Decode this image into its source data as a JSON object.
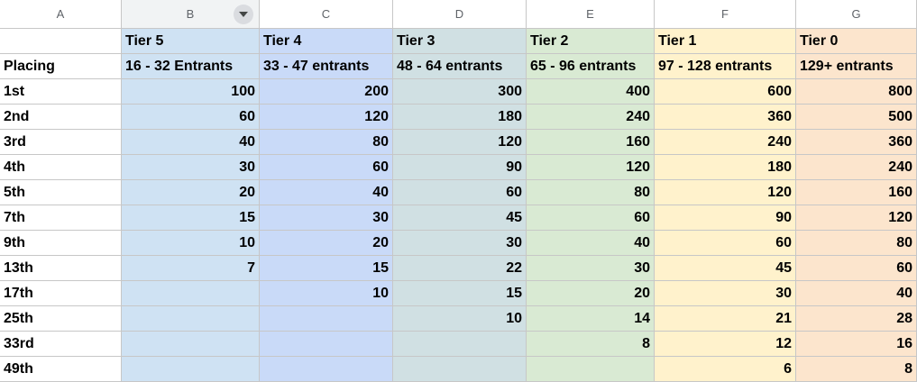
{
  "columns": [
    "A",
    "B",
    "C",
    "D",
    "E",
    "F",
    "G"
  ],
  "icons": {
    "filter": "filter-dropdown-icon"
  },
  "colors": {
    "B": "#cfe2f3",
    "C": "#c9daf8",
    "D": "#d0e0e3",
    "E": "#d9ead3",
    "F": "#fff2cc",
    "G": "#fce5cd"
  },
  "header_rows": [
    [
      "",
      "Tier 5",
      "Tier 4",
      "Tier 3",
      "Tier 2",
      "Tier 1",
      "Tier 0"
    ],
    [
      "Placing",
      "16 - 32 Entrants",
      "33 - 47 entrants",
      "48 - 64 entrants",
      "65 - 96 entrants",
      "97 - 128 entrants",
      "129+ entrants"
    ]
  ],
  "rows": [
    [
      "1st",
      "100",
      "200",
      "300",
      "400",
      "600",
      "800"
    ],
    [
      "2nd",
      "60",
      "120",
      "180",
      "240",
      "360",
      "500"
    ],
    [
      "3rd",
      "40",
      "80",
      "120",
      "160",
      "240",
      "360"
    ],
    [
      "4th",
      "30",
      "60",
      "90",
      "120",
      "180",
      "240"
    ],
    [
      "5th",
      "20",
      "40",
      "60",
      "80",
      "120",
      "160"
    ],
    [
      "7th",
      "15",
      "30",
      "45",
      "60",
      "90",
      "120"
    ],
    [
      "9th",
      "10",
      "20",
      "30",
      "40",
      "60",
      "80"
    ],
    [
      "13th",
      "7",
      "15",
      "22",
      "30",
      "45",
      "60"
    ],
    [
      "17th",
      "",
      "10",
      "15",
      "20",
      "30",
      "40"
    ],
    [
      "25th",
      "",
      "",
      "10",
      "14",
      "21",
      "28"
    ],
    [
      "33rd",
      "",
      "",
      "",
      "8",
      "12",
      "16"
    ],
    [
      "49th",
      "",
      "",
      "",
      "",
      "6",
      "8"
    ]
  ]
}
